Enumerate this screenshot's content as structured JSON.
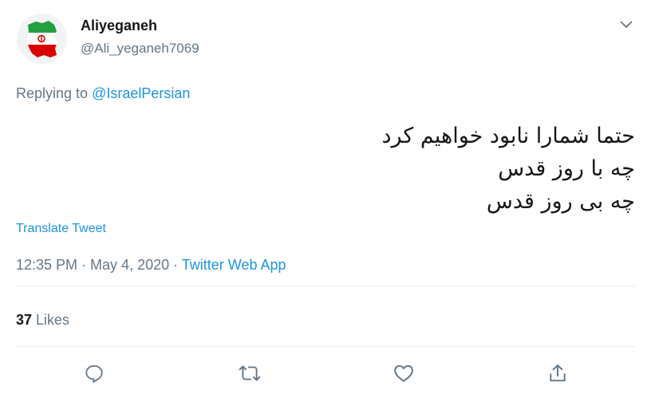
{
  "user": {
    "display_name": "Aliyeganeh",
    "handle": "@Ali_yeganeh7069",
    "avatar_icon": "iran-map-flag-avatar"
  },
  "reply": {
    "prefix": "Replying to ",
    "mention": "@IsraelPersian"
  },
  "tweet": {
    "lines": [
      "حتما شمارا نابود خواهیم کرد",
      "چه با روز قدس",
      "چه بی روز قدس"
    ]
  },
  "translate_label": "Translate Tweet",
  "meta": {
    "time": "12:35 PM",
    "separator": " · ",
    "date": "May 4, 2020",
    "source": "Twitter Web App"
  },
  "stats": {
    "likes_count": "37",
    "likes_label": " Likes"
  },
  "actions": [
    "reply-icon",
    "retweet-icon",
    "like-icon",
    "share-icon"
  ],
  "colors": {
    "link": "#1b95e0",
    "secondary_text": "#657786",
    "icon": "#657786",
    "divider": "#e6ecf0",
    "flag_green": "#239f40",
    "flag_red": "#da0000"
  }
}
